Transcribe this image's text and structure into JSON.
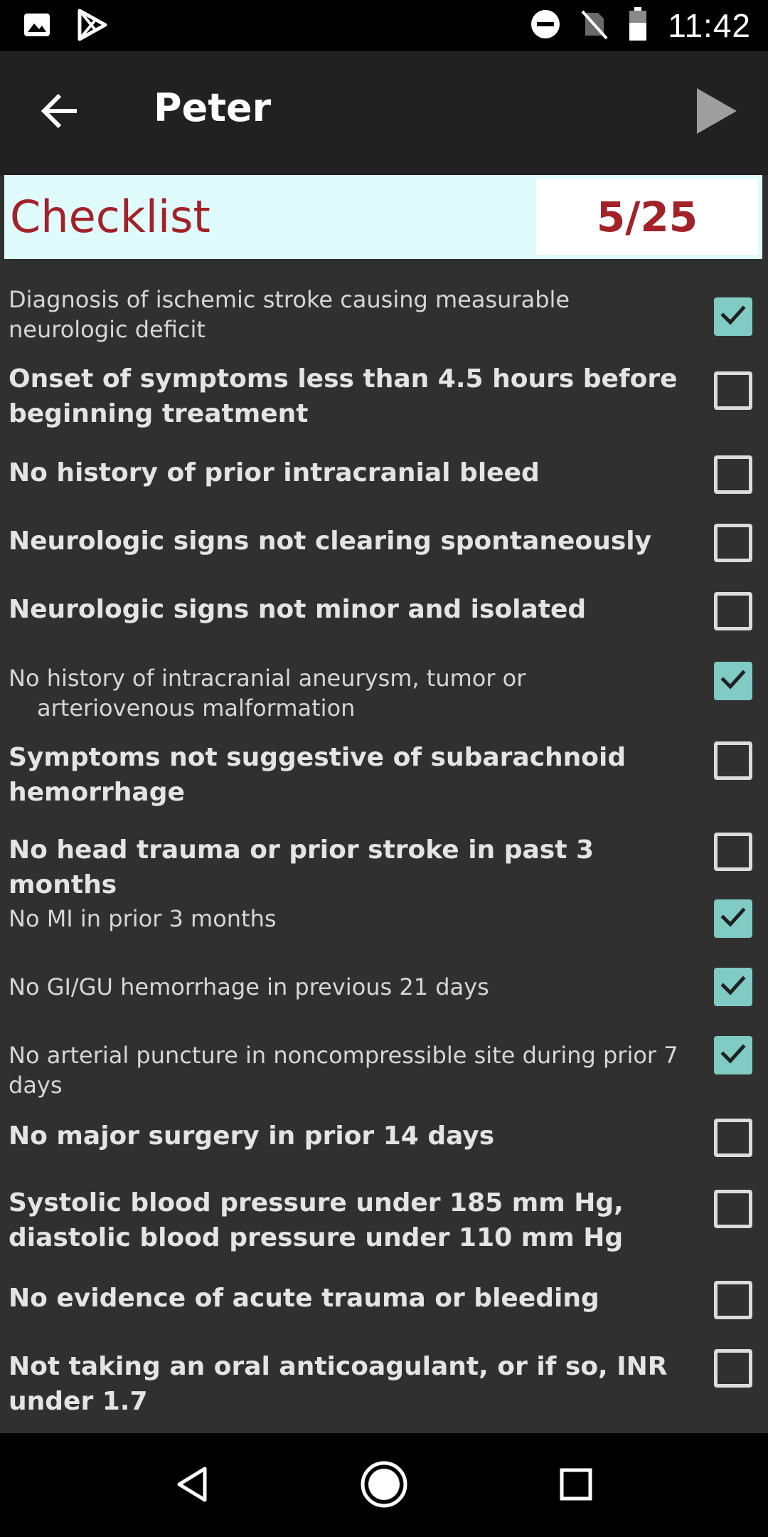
{
  "status_bar": {
    "time": "11:42",
    "icons": [
      "image-icon",
      "play-store-icon",
      "do-not-disturb-icon",
      "no-sim-icon",
      "battery-icon"
    ]
  },
  "app_bar": {
    "title": "Peter",
    "back_icon": "arrow-back-icon",
    "action_icon": "play-icon"
  },
  "checklist": {
    "title": "Checklist",
    "count": "5/25",
    "colors": {
      "header_bg": "#e0fbfb",
      "header_text": "#a32128",
      "checked": "#80cbc4"
    },
    "items": [
      {
        "label": "Diagnosis of ischemic stroke causing measurable neurologic deficit",
        "checked": true
      },
      {
        "label": "Onset of symptoms less than 4.5 hours before beginning treatment",
        "checked": false
      },
      {
        "label": "No history of prior intracranial bleed",
        "checked": false
      },
      {
        "label": "Neurologic signs not clearing spontaneously",
        "checked": false
      },
      {
        "label": "Neurologic signs not minor and isolated",
        "checked": false
      },
      {
        "label": "No history of intracranial aneurysm, tumor or arteriovenous malformation",
        "checked": true
      },
      {
        "label": "Symptoms not suggestive of subarachnoid hemorrhage",
        "checked": false
      },
      {
        "label": "No head trauma or prior stroke in past 3 months",
        "checked": false
      },
      {
        "label": "No MI in prior 3 months",
        "checked": true
      },
      {
        "label": "No GI/GU hemorrhage in previous 21 days",
        "checked": true
      },
      {
        "label": "No arterial puncture in noncompressible site during prior 7 days",
        "checked": true
      },
      {
        "label": "No major surgery in prior 14 days",
        "checked": false
      },
      {
        "label": "Systolic blood pressure under 185 mm Hg, diastolic blood pressure under 110 mm Hg",
        "checked": false
      },
      {
        "label": "No evidence of acute trauma or bleeding",
        "checked": false
      },
      {
        "label": "Not taking an oral anticoagulant, or if so, INR under 1.7",
        "checked": false
      }
    ]
  },
  "nav_bar": {
    "icons": [
      "nav-back-icon",
      "nav-home-icon",
      "nav-recents-icon"
    ]
  }
}
